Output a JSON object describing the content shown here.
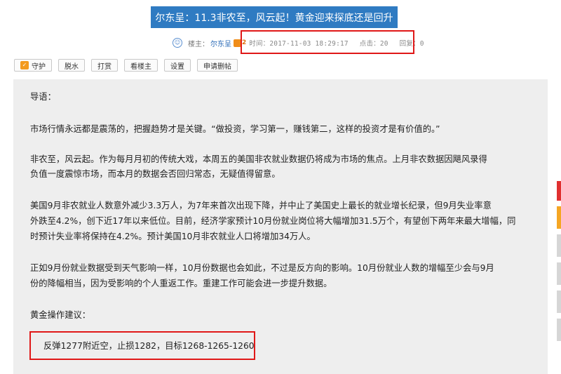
{
  "post": {
    "title": "尔东呈：11.3非农至，风云起！黄金迎来探底还是回升",
    "author_label": "楼主：",
    "author": "尔东呈",
    "author_level": "2",
    "time": "时间：2017-11-03 18:29:17",
    "clicks": "点击：20",
    "replies": "回复：0"
  },
  "toolbar": [
    {
      "label": "守护",
      "icon": "shield-icon"
    },
    {
      "label": "脱水"
    },
    {
      "label": "打赏"
    },
    {
      "label": "看楼主"
    },
    {
      "label": "设置"
    },
    {
      "label": "申请删帖"
    }
  ],
  "body": {
    "intro_heading": "导语：",
    "p1": "市场行情永远都是震荡的，把握趋势才是关键。“做投资，学习第一，赚钱第二，这样的投资才是有价值的。”",
    "p2_line1": "非农至，风云起。作为每月月初的传统大戏，本周五的美国非农就业数据仍将成为市场的焦点。上月非农数据因飓风录得",
    "p2_line2": "负值一度震惊市场，而本月的数据会否回归常态，无疑值得留意。",
    "p3_line1": "美国9月非农就业人数意外减少3.3万人，为7年来首次出现下降，并中止了美国史上最长的就业增长纪录，但9月失业率意",
    "p3_line2": "外跌至4.2%，创下近17年以来低位。目前，经济学家预计10月份就业岗位将大幅增加31.5万个，有望创下两年来最大增幅，同",
    "p3_line3": "时预计失业率将保持在4.2%。预计美国10月非农就业人口将增加34万人。",
    "p4_line1": "正如9月份就业数据受到天气影响一样，10月份数据也会如此，不过是反方向的影响。10月份就业人数的增幅至少会与9月",
    "p4_line2": "份的降幅相当，因为受影响的个人重返工作。重建工作可能会进一步提升数据。",
    "advice_heading": "黄金操作建议：",
    "advice": "反弹1277附近空，止损1282，目标1268-1265-1260"
  },
  "colors": {
    "title_bg": "#2f7bc2",
    "highlight_border": "#e01818",
    "content_bg": "#eeeeee"
  }
}
